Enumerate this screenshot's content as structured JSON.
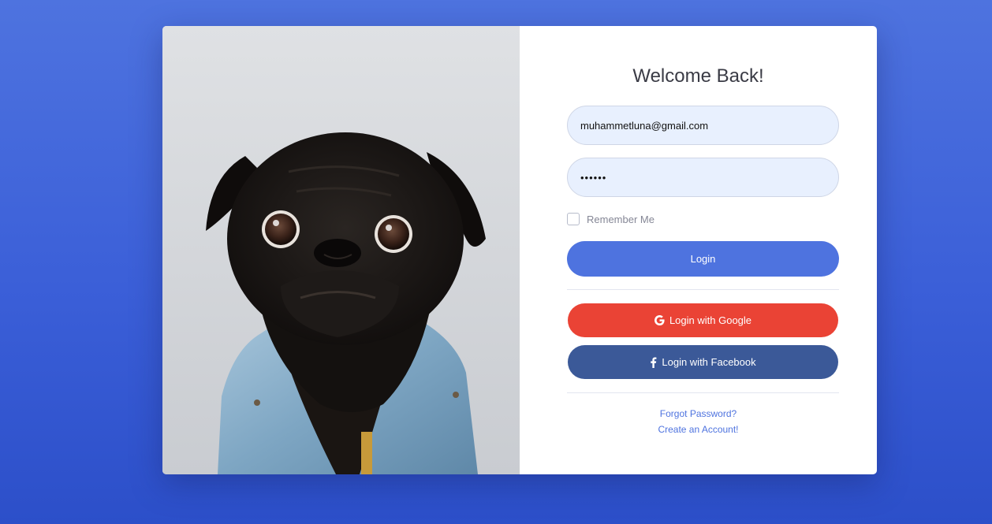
{
  "form": {
    "title": "Welcome Back!",
    "email_value": "muhammetluna@gmail.com",
    "password_masked": "••••••",
    "remember_label": "Remember Me",
    "remember_checked": false,
    "login_label": "Login",
    "google_label": "Login with Google",
    "facebook_label": "Login with Facebook",
    "forgot_label": "Forgot Password?",
    "create_label": "Create an Account!"
  },
  "colors": {
    "primary": "#4e73df",
    "google": "#ea4335",
    "facebook": "#3b5998",
    "input_bg": "#e8f0fe"
  },
  "icons": {
    "google": "google-icon",
    "facebook": "facebook-icon"
  }
}
